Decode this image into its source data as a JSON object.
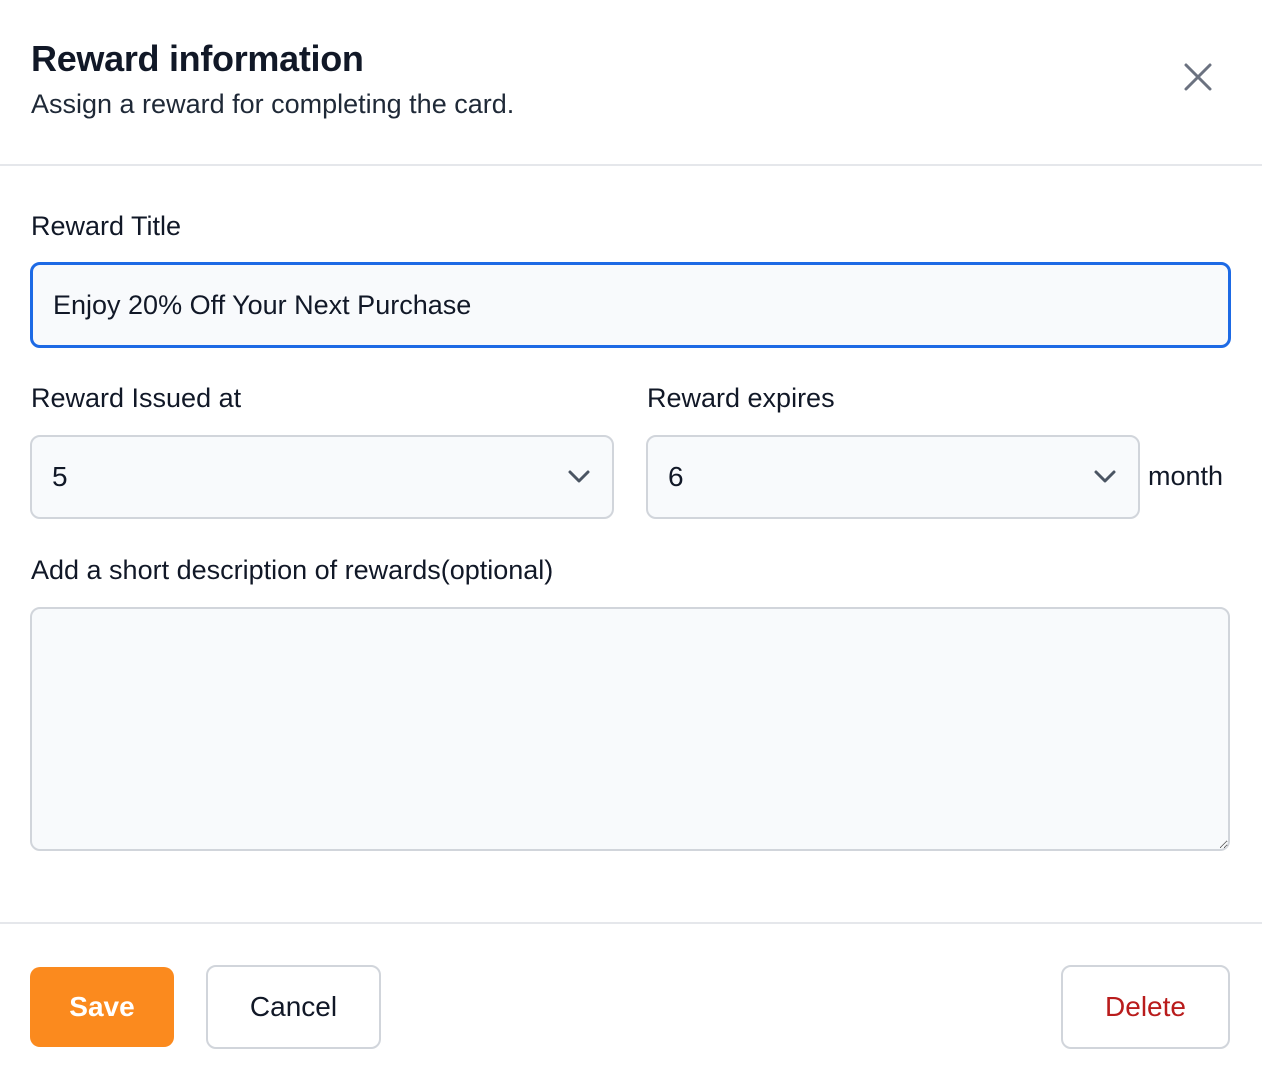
{
  "dialog": {
    "title": "Reward information",
    "subtitle": "Assign a reward for completing the card.",
    "close_icon": "close-icon"
  },
  "form": {
    "reward_title": {
      "label": "Reward Title",
      "value": "Enjoy 20% Off Your Next Purchase"
    },
    "reward_issued_at": {
      "label": "Reward Issued at",
      "value": "5",
      "icon": "chevron-down-icon"
    },
    "reward_expires": {
      "label": "Reward expires",
      "value": "6",
      "suffix": "month",
      "icon": "chevron-down-icon"
    },
    "description": {
      "label": "Add a short description of rewards(optional)",
      "value": ""
    }
  },
  "footer": {
    "save_label": "Save",
    "cancel_label": "Cancel",
    "delete_label": "Delete"
  },
  "colors": {
    "accent": "#fb8a1e",
    "focus": "#1d6ae5",
    "danger": "#b91c1c"
  }
}
